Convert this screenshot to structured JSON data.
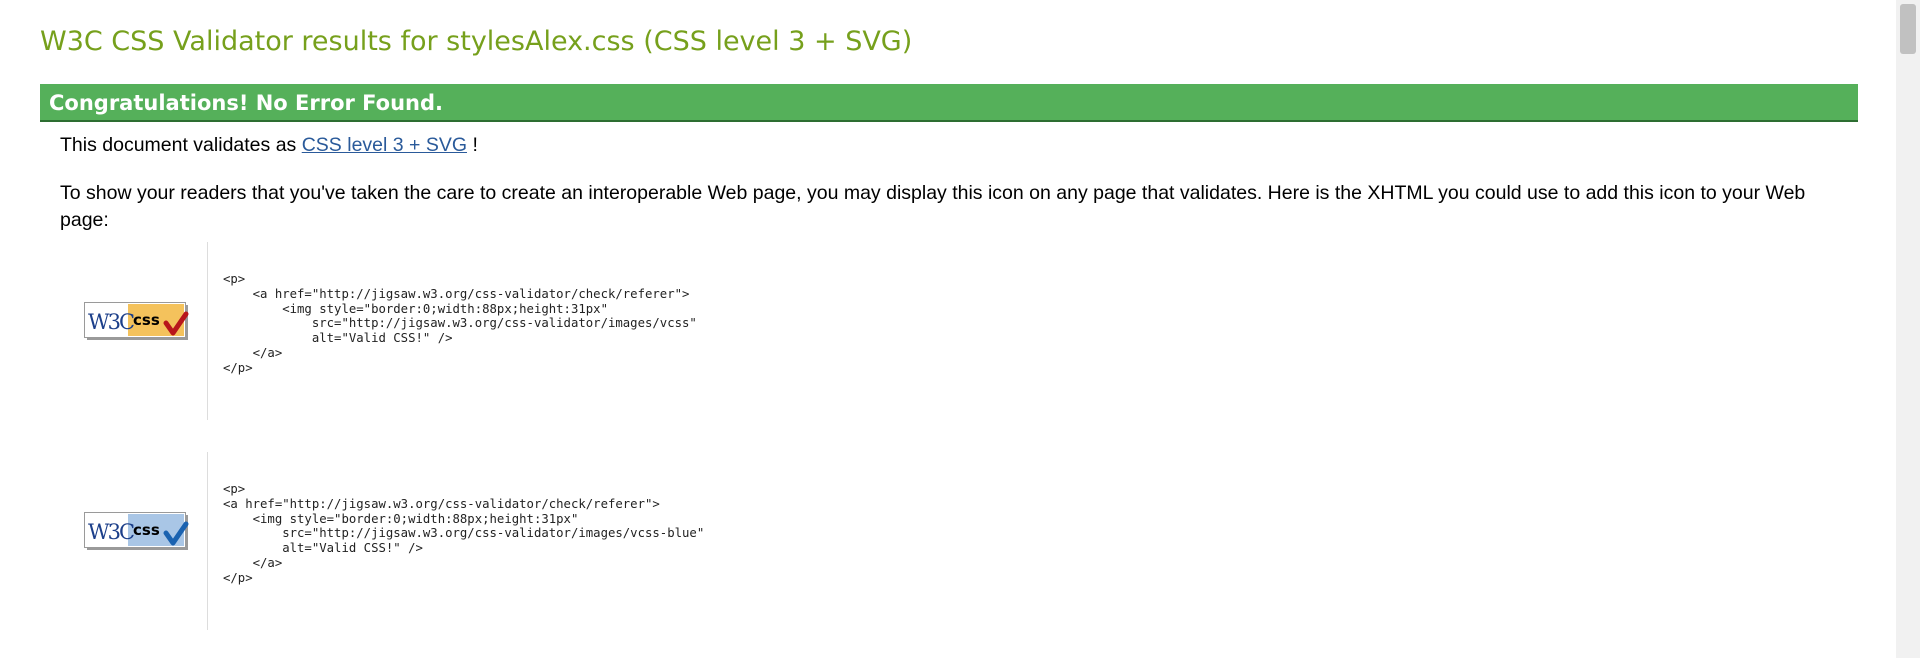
{
  "page": {
    "title": "W3C CSS Validator results for stylesAlex.css (CSS level 3 + SVG)",
    "congrats": "Congratulations! No Error Found.",
    "validates_prefix": "This document validates as",
    "validates_link": "CSS level 3 + SVG",
    "validates_suffix": "!",
    "show_text": "To show your readers that you've taken the care to create an interoperable Web page, you may display this icon on any page that validates. Here is the XHTML you could use to add this icon to your Web page:"
  },
  "badges": [
    {
      "icon": "w3c-css-badge-gold",
      "w3c": "W3C",
      "css": "css",
      "code": "<p>\n    <a href=\"http://jigsaw.w3.org/css-validator/check/referer\">\n        <img style=\"border:0;width:88px;height:31px\"\n            src=\"http://jigsaw.w3.org/css-validator/images/vcss\"\n            alt=\"Valid CSS!\" />\n    </a>\n</p>"
    },
    {
      "icon": "w3c-css-badge-blue",
      "w3c": "W3C",
      "css": "css",
      "code": "<p>\n<a href=\"http://jigsaw.w3.org/css-validator/check/referer\">\n    <img style=\"border:0;width:88px;height:31px\"\n        src=\"http://jigsaw.w3.org/css-validator/images/vcss-blue\"\n        alt=\"Valid CSS!\" />\n    </a>\n</p>"
    }
  ],
  "colors": {
    "title": "#76a01c",
    "congrats_bg": "#55b05a",
    "link": "#2a5a9a",
    "badge_gold": "#f4c25c",
    "badge_blue": "#a9c6e6",
    "check_red": "#b8161b",
    "check_blue": "#1a62b0"
  }
}
